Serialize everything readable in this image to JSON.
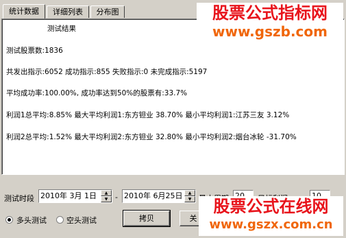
{
  "tabs": [
    "统计数据",
    "详细列表",
    "分布图"
  ],
  "results": {
    "title": "测试结果",
    "total_stocks": "测试股票数:1836",
    "signals": "共发出指示:6052 成功指示:855 失败指示:0 未完成指示:5197",
    "success_rate": "平均成功率:100.00%, 成功率达到50%的股票有:33.7%",
    "profit1": "利润1总平均:8.85% 最大平均利润1:东方钽业 38.70% 最小平均利润1:江苏三友 3.12%",
    "profit2": "利润2总平均:1.52% 最大平均利润2:东方钽业 32.80% 最小平均利润2:烟台冰轮 -31.70%"
  },
  "controls": {
    "period_label": "测试时段",
    "start_date": "2010年 3月 1日",
    "separator": "-",
    "end_date": "2010年 6月25日",
    "field_label_1": "最大周期",
    "field_value_1": "20",
    "field_label_2": "目标利润",
    "field_value_2": "10",
    "radio_long": "多头测试",
    "radio_short": "空头测试",
    "copy_button": "拷贝",
    "second_button": "关"
  },
  "watermarks": {
    "top_line1": "股票公式指标网",
    "top_line2": "www.gszb.com",
    "bottom_line1": "股票公式在线网",
    "bottom_line2": "www.gszx.com.cn"
  },
  "colors": {
    "watermark_red": "#e8131b",
    "watermark_orange": "#f0660a",
    "window_bg": "#d4d0c8"
  }
}
